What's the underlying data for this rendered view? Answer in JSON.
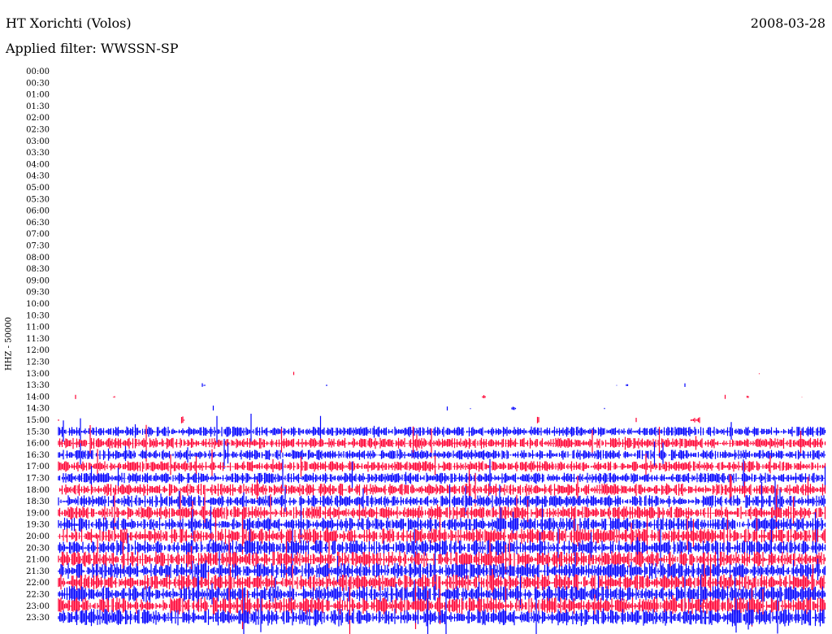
{
  "header": {
    "station": "HT Xorichti (Volos)",
    "date": "2008-03-28",
    "filter": "Applied filter: WWSSN-SP"
  },
  "colors": {
    "trace_a": "#ff0033",
    "trace_b": "#0000ff"
  },
  "chart_data": {
    "type": "helicorder",
    "ylabel": "HHZ - 50000",
    "rows": [
      {
        "time": "00:00",
        "level": 0
      },
      {
        "time": "00:30",
        "level": 0
      },
      {
        "time": "01:00",
        "level": 0
      },
      {
        "time": "01:30",
        "level": 0
      },
      {
        "time": "02:00",
        "level": 0
      },
      {
        "time": "02:30",
        "level": 0
      },
      {
        "time": "03:00",
        "level": 0
      },
      {
        "time": "03:30",
        "level": 0
      },
      {
        "time": "04:00",
        "level": 0
      },
      {
        "time": "04:30",
        "level": 0
      },
      {
        "time": "05:00",
        "level": 0
      },
      {
        "time": "05:30",
        "level": 0
      },
      {
        "time": "06:00",
        "level": 0
      },
      {
        "time": "06:30",
        "level": 0
      },
      {
        "time": "07:00",
        "level": 0
      },
      {
        "time": "07:30",
        "level": 0
      },
      {
        "time": "08:00",
        "level": 0
      },
      {
        "time": "08:30",
        "level": 0
      },
      {
        "time": "09:00",
        "level": 0
      },
      {
        "time": "09:30",
        "level": 0
      },
      {
        "time": "10:00",
        "level": 0
      },
      {
        "time": "10:30",
        "level": 0
      },
      {
        "time": "11:00",
        "level": 0
      },
      {
        "time": "11:30",
        "level": 0
      },
      {
        "time": "12:00",
        "level": 0
      },
      {
        "time": "12:30",
        "level": 0
      },
      {
        "time": "13:00",
        "level": 0.05
      },
      {
        "time": "13:30",
        "level": 0.08
      },
      {
        "time": "14:00",
        "level": 0.15
      },
      {
        "time": "14:30",
        "level": 0.22
      },
      {
        "time": "15:00",
        "level": 0.3
      },
      {
        "time": "15:30",
        "level": 0.5
      },
      {
        "time": "16:00",
        "level": 0.55
      },
      {
        "time": "16:30",
        "level": 0.5
      },
      {
        "time": "17:00",
        "level": 0.55
      },
      {
        "time": "17:30",
        "level": 0.55
      },
      {
        "time": "18:00",
        "level": 0.65
      },
      {
        "time": "18:30",
        "level": 0.65
      },
      {
        "time": "19:00",
        "level": 0.72
      },
      {
        "time": "19:30",
        "level": 0.78
      },
      {
        "time": "20:00",
        "level": 0.85
      },
      {
        "time": "20:30",
        "level": 0.88
      },
      {
        "time": "21:00",
        "level": 0.9
      },
      {
        "time": "21:30",
        "level": 0.92
      },
      {
        "time": "22:00",
        "level": 0.95
      },
      {
        "time": "22:30",
        "level": 0.95
      },
      {
        "time": "23:00",
        "level": 0.97
      },
      {
        "time": "23:30",
        "level": 1.0
      }
    ]
  }
}
